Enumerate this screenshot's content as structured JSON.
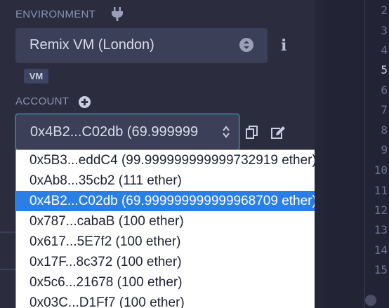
{
  "environment": {
    "label": "ENVIRONMENT",
    "selected": "Remix VM (London)",
    "badge": "VM"
  },
  "account": {
    "label": "ACCOUNT",
    "selected_display": "0x4B2...C02db (69.999999",
    "options": [
      "0x5B3...eddC4 (99.999999999999732919 ether)",
      "0xAb8...35cb2 (111 ether)",
      "0x4B2...C02db (69.999999999999968709 ether)",
      "0x787...cabaB (100 ether)",
      "0x617...5E7f2 (100 ether)",
      "0x17F...8c372 (100 ether)",
      "0x5c6...21678 (100 ether)",
      "0x03C...D1Ff7 (100 ether)"
    ],
    "selected_index": 2
  },
  "editor": {
    "line_numbers": [
      "2",
      "3",
      "4",
      "5",
      "6",
      "7",
      "8",
      "9",
      "10",
      "11",
      "12",
      "13",
      "14",
      "15"
    ],
    "active_line": "5"
  },
  "icons": {
    "environment": "plug-icon",
    "environment_select": "updown-circle-icon",
    "info": "info-icon",
    "account_add": "plus-circle-icon",
    "account_select": "chevron-updown-icon",
    "copy": "copy-icon",
    "edit": "edit-icon"
  },
  "colors": {
    "panel_bg": "#2b2d3e",
    "select_bg": "#3b3f57",
    "highlight": "#2a7fe6",
    "label": "#8a93b4"
  }
}
